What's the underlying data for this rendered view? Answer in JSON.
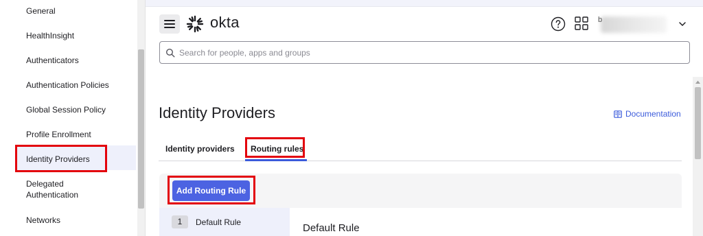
{
  "sidebar": {
    "items": [
      {
        "label": "General"
      },
      {
        "label": "HealthInsight"
      },
      {
        "label": "Authenticators"
      },
      {
        "label": "Authentication Policies"
      },
      {
        "label": "Global Session Policy"
      },
      {
        "label": "Profile Enrollment"
      },
      {
        "label": "Identity Providers"
      },
      {
        "label": "Delegated Authentication"
      },
      {
        "label": "Networks"
      }
    ],
    "active_item": "Identity Providers"
  },
  "header": {
    "brand": "okta",
    "account_initial": "b",
    "icons": [
      "menu-icon",
      "okta-logo",
      "help-icon",
      "apps-grid-icon",
      "chevron-down-icon"
    ]
  },
  "search": {
    "placeholder": "Search for people, apps and groups",
    "value": ""
  },
  "page": {
    "title": "Identity Providers",
    "documentation_link": "Documentation"
  },
  "tabs": [
    {
      "label": "Identity providers",
      "active": false
    },
    {
      "label": "Routing rules",
      "active": true
    }
  ],
  "routing": {
    "add_button": "Add Routing Rule",
    "rules": [
      {
        "number": "1",
        "name": "Default Rule"
      }
    ],
    "selected_rule_title": "Default Rule"
  },
  "colors": {
    "accent": "#4c63e2",
    "link": "#3b5bdb",
    "highlight": "#e3000b",
    "active_bg": "#eef0fb"
  }
}
